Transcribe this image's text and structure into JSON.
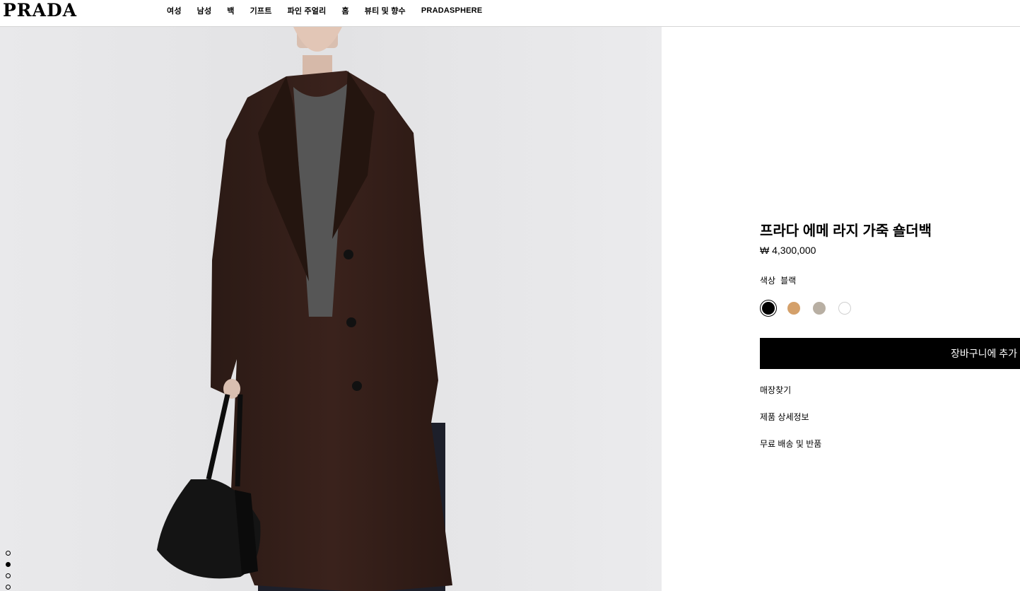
{
  "header": {
    "logo": "PRADA",
    "nav": [
      "여성",
      "남성",
      "백",
      "기프트",
      "파인 주얼리",
      "홈",
      "뷰티 및 향수",
      "PRADASPHERE"
    ]
  },
  "gallery": {
    "image_count": 6,
    "active_index": 1
  },
  "product": {
    "title": "프라다 에메 라지 가죽 숄더백",
    "price": "₩ 4,300,000",
    "color_label": "색상",
    "color_value": "블랙",
    "swatches": [
      {
        "name": "black",
        "color": "#000000",
        "selected": true
      },
      {
        "name": "caramel",
        "color": "#d4a06a",
        "selected": false
      },
      {
        "name": "taupe",
        "color": "#b8afa3",
        "selected": false
      },
      {
        "name": "white",
        "color": "#ffffff",
        "selected": false
      }
    ],
    "cart_button": "장바구니에 추가",
    "links": {
      "store": "매장찾기",
      "details": "제품 상세정보",
      "shipping": "무료 배송 및 반품"
    }
  }
}
